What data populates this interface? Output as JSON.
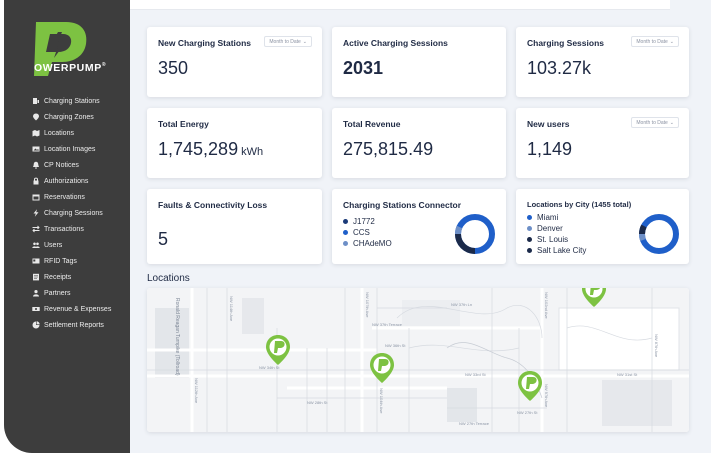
{
  "brand": {
    "name": "OWERPUMP",
    "tm": "®",
    "color": "#7dc242"
  },
  "sidebar": {
    "items": [
      {
        "label": "Charging Stations",
        "icon": "charging-station-icon"
      },
      {
        "label": "Charging Zones",
        "icon": "location-pin-icon"
      },
      {
        "label": "Locations",
        "icon": "map-icon"
      },
      {
        "label": "Location Images",
        "icon": "image-icon"
      },
      {
        "label": "CP Notices",
        "icon": "bell-icon"
      },
      {
        "label": "Authorizations",
        "icon": "lock-icon"
      },
      {
        "label": "Reservations",
        "icon": "calendar-icon"
      },
      {
        "label": "Charging Sessions",
        "icon": "lightning-icon"
      },
      {
        "label": "Transactions",
        "icon": "exchange-icon"
      },
      {
        "label": "Users",
        "icon": "users-icon"
      },
      {
        "label": "RFID Tags",
        "icon": "id-card-icon"
      },
      {
        "label": "Receipts",
        "icon": "receipt-icon"
      },
      {
        "label": "Partners",
        "icon": "partner-icon"
      },
      {
        "label": "Revenue & Expenses",
        "icon": "money-icon"
      },
      {
        "label": "Settlement Reports",
        "icon": "pie-chart-icon"
      }
    ]
  },
  "cards": {
    "new_stations": {
      "title": "New Charging Stations",
      "value": "350",
      "dropdown": "Month to Date"
    },
    "active_sessions": {
      "title": "Active Charging Sessions",
      "value": "2031"
    },
    "sessions": {
      "title": "Charging Sessions",
      "value": "103.27k",
      "dropdown": "Month to Date"
    },
    "energy": {
      "title": "Total Energy",
      "value": "1,745,289",
      "unit": "kWh"
    },
    "revenue": {
      "title": "Total Revenue",
      "value": "275,815.49"
    },
    "new_users": {
      "title": "New users",
      "value": "1,149",
      "dropdown": "Month to Date"
    },
    "faults": {
      "title": "Faults & Connectivity Loss",
      "value": "5"
    },
    "connector": {
      "title": "Charging Stations Connector",
      "legend": [
        {
          "label": "J1772",
          "color": "#1b3a78"
        },
        {
          "label": "CCS",
          "color": "#1f5fc9"
        },
        {
          "label": "CHAdeMO",
          "color": "#6d8fc7"
        }
      ]
    },
    "cities": {
      "title": "Locations by City (1455 total)",
      "legend": [
        {
          "label": "Miami",
          "color": "#1f5fc9"
        },
        {
          "label": "Denver",
          "color": "#6d8fc7"
        },
        {
          "label": "St. Louis",
          "color": "#1b2a4a"
        },
        {
          "label": "Salt Lake City",
          "color": "#1b2a4a"
        }
      ]
    }
  },
  "locations": {
    "title": "Locations",
    "streets": {
      "turnpike": "Ronald Reagan Turnpike (Tollroad)",
      "ave_114": "NW 114th Ave",
      "ave_112": "NW 112th Ave",
      "ave_107": "NW 107th Ave",
      "ave_104": "NW 104th Ave",
      "ave_102": "NW 102nd Ave",
      "ave_97": "NW 97th Ave",
      "ave_87": "NW 87th Ave",
      "terrace_37": "NW 37th Terrace",
      "st_36": "NW 36th St",
      "st_34": "NW 34th St",
      "st_33": "NW 33rd St",
      "st_31": "NW 31st St",
      "st_28": "NW 28th St",
      "st_27": "NW 27th St",
      "terrace_27": "NW 27th Terrace",
      "lane_37": "NW 37th Ln"
    }
  },
  "colors": {
    "sidebar": "#3d3d3d",
    "accent_green": "#7dc242",
    "donut_blue": "#1f5fc9",
    "donut_dark": "#1b2a4a",
    "text": "#1f2a44"
  }
}
